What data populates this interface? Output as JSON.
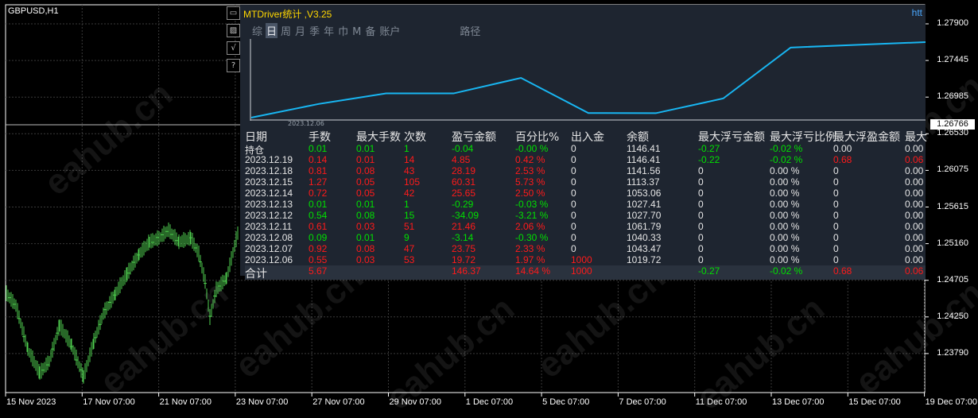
{
  "chart": {
    "symbol_title": "GBPUSD,H1",
    "current_price": "1.26766",
    "price_labels": [
      "1.27900",
      "1.27445",
      "1.26985",
      "1.26530",
      "1.26075",
      "1.25615",
      "1.25160",
      "1.24705",
      "1.24250",
      "1.23790"
    ],
    "time_labels": [
      "15 Nov 2023",
      "17 Nov 07:00",
      "21 Nov 07:00",
      "23 Nov 07:00",
      "27 Nov 07:00",
      "29 Nov 07:00",
      "1 Dec 07:00",
      "5 Dec 07:00",
      "7 Dec 07:00",
      "11 Dec 07:00",
      "13 Dec 07:00",
      "15 Dec 07:00",
      "19 Dec 07:00"
    ],
    "watermark_text": "eahub.cn",
    "colors": {
      "background": "#000000",
      "grid": "#3a3a3a",
      "candles": "#4fd04f",
      "axis": "#ffffff"
    }
  },
  "side_buttons": [
    {
      "icon": "minimize-icon",
      "glyph": "▭"
    },
    {
      "icon": "image-icon",
      "glyph": "▨"
    },
    {
      "icon": "check-icon",
      "glyph": "√"
    },
    {
      "icon": "help-icon",
      "glyph": "?"
    }
  ],
  "panel": {
    "title": "MTDriver统计 ,V3.25",
    "link_text": "htt",
    "tabs": [
      "综",
      "日",
      "周",
      "月",
      "季",
      "年",
      "巾",
      "M",
      "备",
      "账户",
      "路径"
    ],
    "active_tab": "日",
    "mini_chart": {
      "date_label": "2023.12.06",
      "line_color": "#18b6f2",
      "values": [
        1019.72,
        1043.47,
        1061.79,
        1061.79,
        1088.8,
        1027.7,
        1027.41,
        1053.06,
        1141.56,
        1146.41,
        1151.0
      ]
    },
    "columns": [
      "日期",
      "手数",
      "最大手数",
      "次数",
      "盈亏金额",
      "百分比%",
      "出入金",
      "余额",
      "最大浮亏金额",
      "最大浮亏比例",
      "最大浮盈金额",
      "最大"
    ],
    "rows": [
      {
        "date": "持仓",
        "lots": "0.01",
        "max_lots": "0.01",
        "count": "1",
        "pnl": "-0.04",
        "pct": "-0.00 %",
        "deposit": "0",
        "balance": "1146.41",
        "max_float_loss": "-0.27",
        "max_float_loss_pct": "-0.02 %",
        "max_float_profit": "0.00",
        "last": "0.00",
        "tone": "g"
      },
      {
        "date": "2023.12.19",
        "lots": "0.14",
        "max_lots": "0.01",
        "count": "14",
        "pnl": "4.85",
        "pct": "0.42 %",
        "deposit": "0",
        "balance": "1146.41",
        "max_float_loss": "-0.22",
        "max_float_loss_pct": "-0.02 %",
        "max_float_profit": "0.68",
        "last": "0.06",
        "tone": "r"
      },
      {
        "date": "2023.12.18",
        "lots": "0.81",
        "max_lots": "0.08",
        "count": "43",
        "pnl": "28.19",
        "pct": "2.53 %",
        "deposit": "0",
        "balance": "1141.56",
        "max_float_loss": "0",
        "max_float_loss_pct": "0.00 %",
        "max_float_profit": "0",
        "last": "0.00",
        "tone": "r"
      },
      {
        "date": "2023.12.15",
        "lots": "1.27",
        "max_lots": "0.05",
        "count": "105",
        "pnl": "60.31",
        "pct": "5.73 %",
        "deposit": "0",
        "balance": "1113.37",
        "max_float_loss": "0",
        "max_float_loss_pct": "0.00 %",
        "max_float_profit": "0",
        "last": "0.00",
        "tone": "r"
      },
      {
        "date": "2023.12.14",
        "lots": "0.72",
        "max_lots": "0.05",
        "count": "42",
        "pnl": "25.65",
        "pct": "2.50 %",
        "deposit": "0",
        "balance": "1053.06",
        "max_float_loss": "0",
        "max_float_loss_pct": "0.00 %",
        "max_float_profit": "0",
        "last": "0.00",
        "tone": "r"
      },
      {
        "date": "2023.12.13",
        "lots": "0.01",
        "max_lots": "0.01",
        "count": "1",
        "pnl": "-0.29",
        "pct": "-0.03 %",
        "deposit": "0",
        "balance": "1027.41",
        "max_float_loss": "0",
        "max_float_loss_pct": "0.00 %",
        "max_float_profit": "0",
        "last": "0.00",
        "tone": "g"
      },
      {
        "date": "2023.12.12",
        "lots": "0.54",
        "max_lots": "0.08",
        "count": "15",
        "pnl": "-34.09",
        "pct": "-3.21 %",
        "deposit": "0",
        "balance": "1027.70",
        "max_float_loss": "0",
        "max_float_loss_pct": "0.00 %",
        "max_float_profit": "0",
        "last": "0.00",
        "tone": "g"
      },
      {
        "date": "2023.12.11",
        "lots": "0.61",
        "max_lots": "0.03",
        "count": "51",
        "pnl": "21.46",
        "pct": "2.06 %",
        "deposit": "0",
        "balance": "1061.79",
        "max_float_loss": "0",
        "max_float_loss_pct": "0.00 %",
        "max_float_profit": "0",
        "last": "0.00",
        "tone": "r"
      },
      {
        "date": "2023.12.08",
        "lots": "0.09",
        "max_lots": "0.01",
        "count": "9",
        "pnl": "-3.14",
        "pct": "-0.30 %",
        "deposit": "0",
        "balance": "1040.33",
        "max_float_loss": "0",
        "max_float_loss_pct": "0.00 %",
        "max_float_profit": "0",
        "last": "0.00",
        "tone": "g"
      },
      {
        "date": "2023.12.07",
        "lots": "0.92",
        "max_lots": "0.08",
        "count": "47",
        "pnl": "23.75",
        "pct": "2.33 %",
        "deposit": "0",
        "balance": "1043.47",
        "max_float_loss": "0",
        "max_float_loss_pct": "0.00 %",
        "max_float_profit": "0",
        "last": "0.00",
        "tone": "r"
      },
      {
        "date": "2023.12.06",
        "lots": "0.55",
        "max_lots": "0.03",
        "count": "53",
        "pnl": "19.72",
        "pct": "1.97 %",
        "deposit": "1000",
        "balance": "1019.72",
        "max_float_loss": "0",
        "max_float_loss_pct": "0.00 %",
        "max_float_profit": "0",
        "last": "0.00",
        "tone": "r"
      }
    ],
    "total": {
      "label": "合计",
      "lots": "5.67",
      "pnl": "146.37",
      "pct": "14.64 %",
      "deposit": "1000",
      "max_float_loss": "-0.27",
      "max_float_loss_pct": "-0.02 %",
      "max_float_profit": "0.68",
      "last": "0.06"
    },
    "colors": {
      "panel_bg": "#1e2530",
      "title": "#ffd700",
      "positive": "#ff1a1a",
      "negative": "#00e000",
      "text": "#e6e6e6"
    }
  }
}
